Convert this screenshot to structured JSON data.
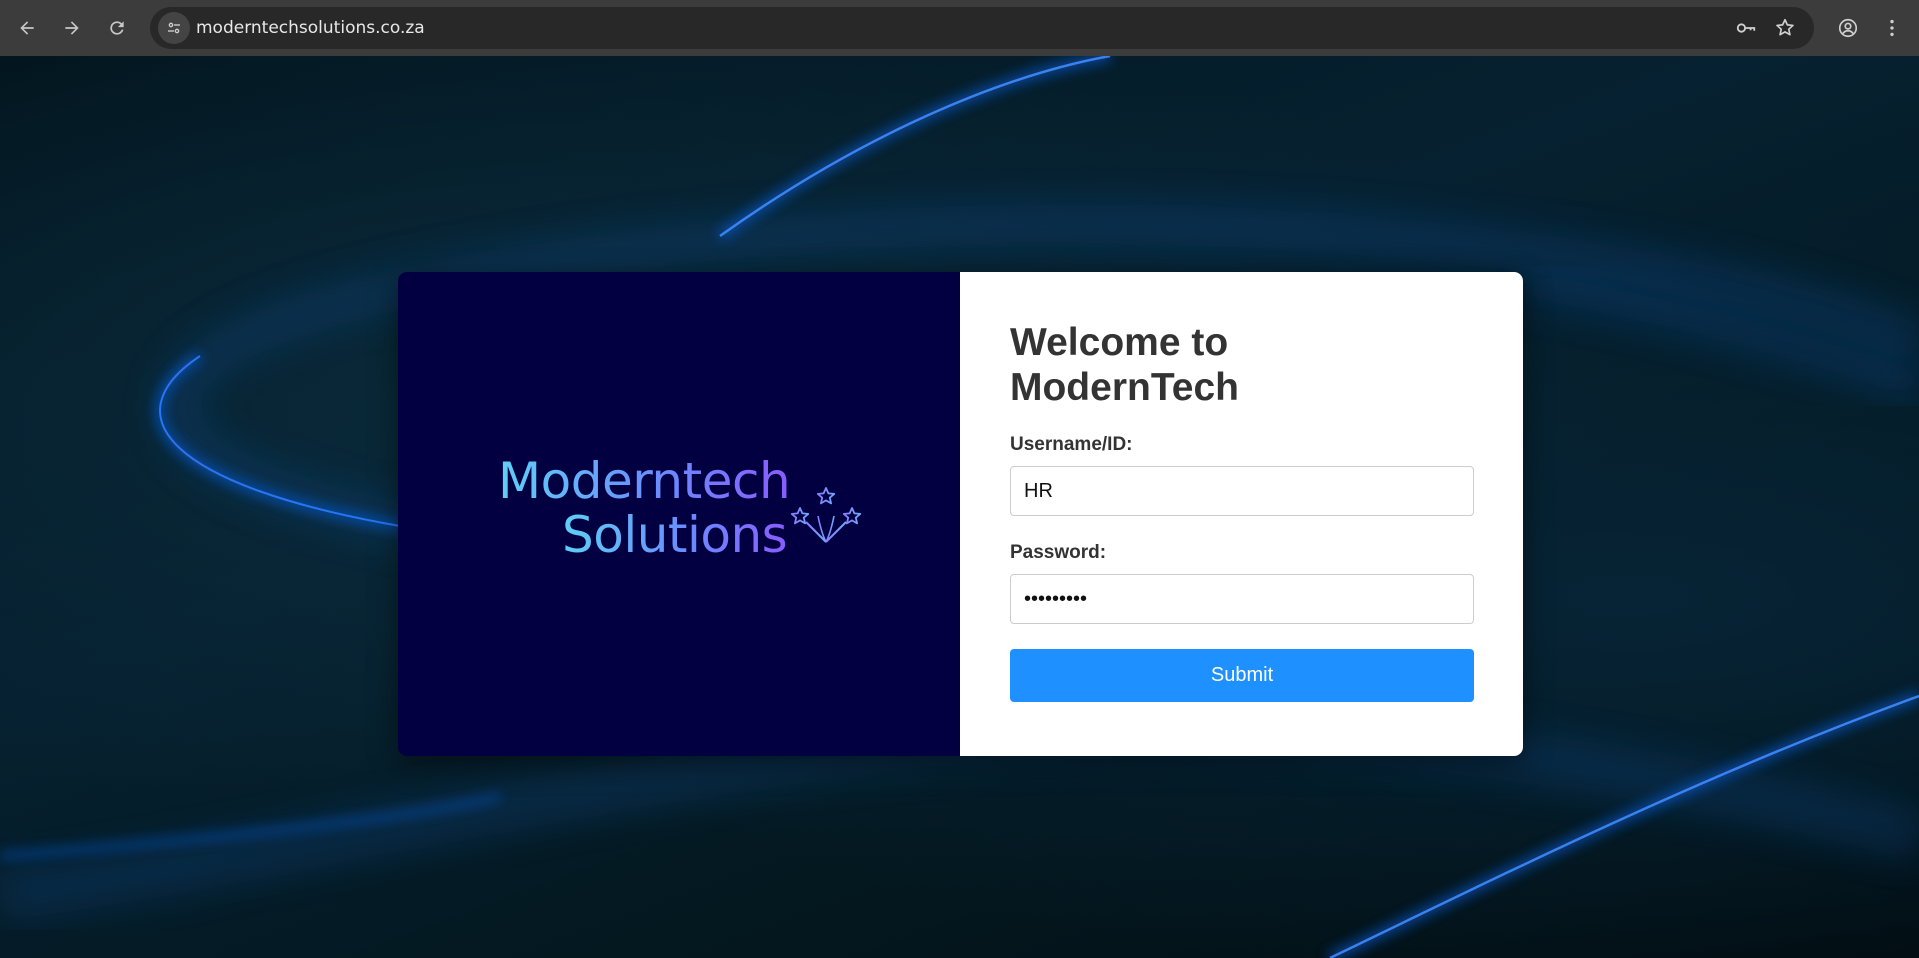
{
  "browser": {
    "url": "moderntechsolutions.co.za",
    "icons": {
      "back": "back-arrow-icon",
      "forward": "forward-arrow-icon",
      "reload": "reload-icon",
      "site_info": "site-settings-icon",
      "password_key": "key-icon",
      "bookmark": "star-icon",
      "profile": "account-icon",
      "menu": "more-vert-icon"
    }
  },
  "brand": {
    "logo_line1": "Moderntech",
    "logo_line2": "Solutions",
    "logo_mark": "stars-fireworks-icon",
    "panel_color": "#020040"
  },
  "login": {
    "title": "Welcome to ModernTech",
    "username_label": "Username/ID:",
    "username_value": "HR",
    "password_label": "Password:",
    "password_value": "•••••••••",
    "submit_label": "Submit",
    "accent_color": "#1e90ff"
  }
}
